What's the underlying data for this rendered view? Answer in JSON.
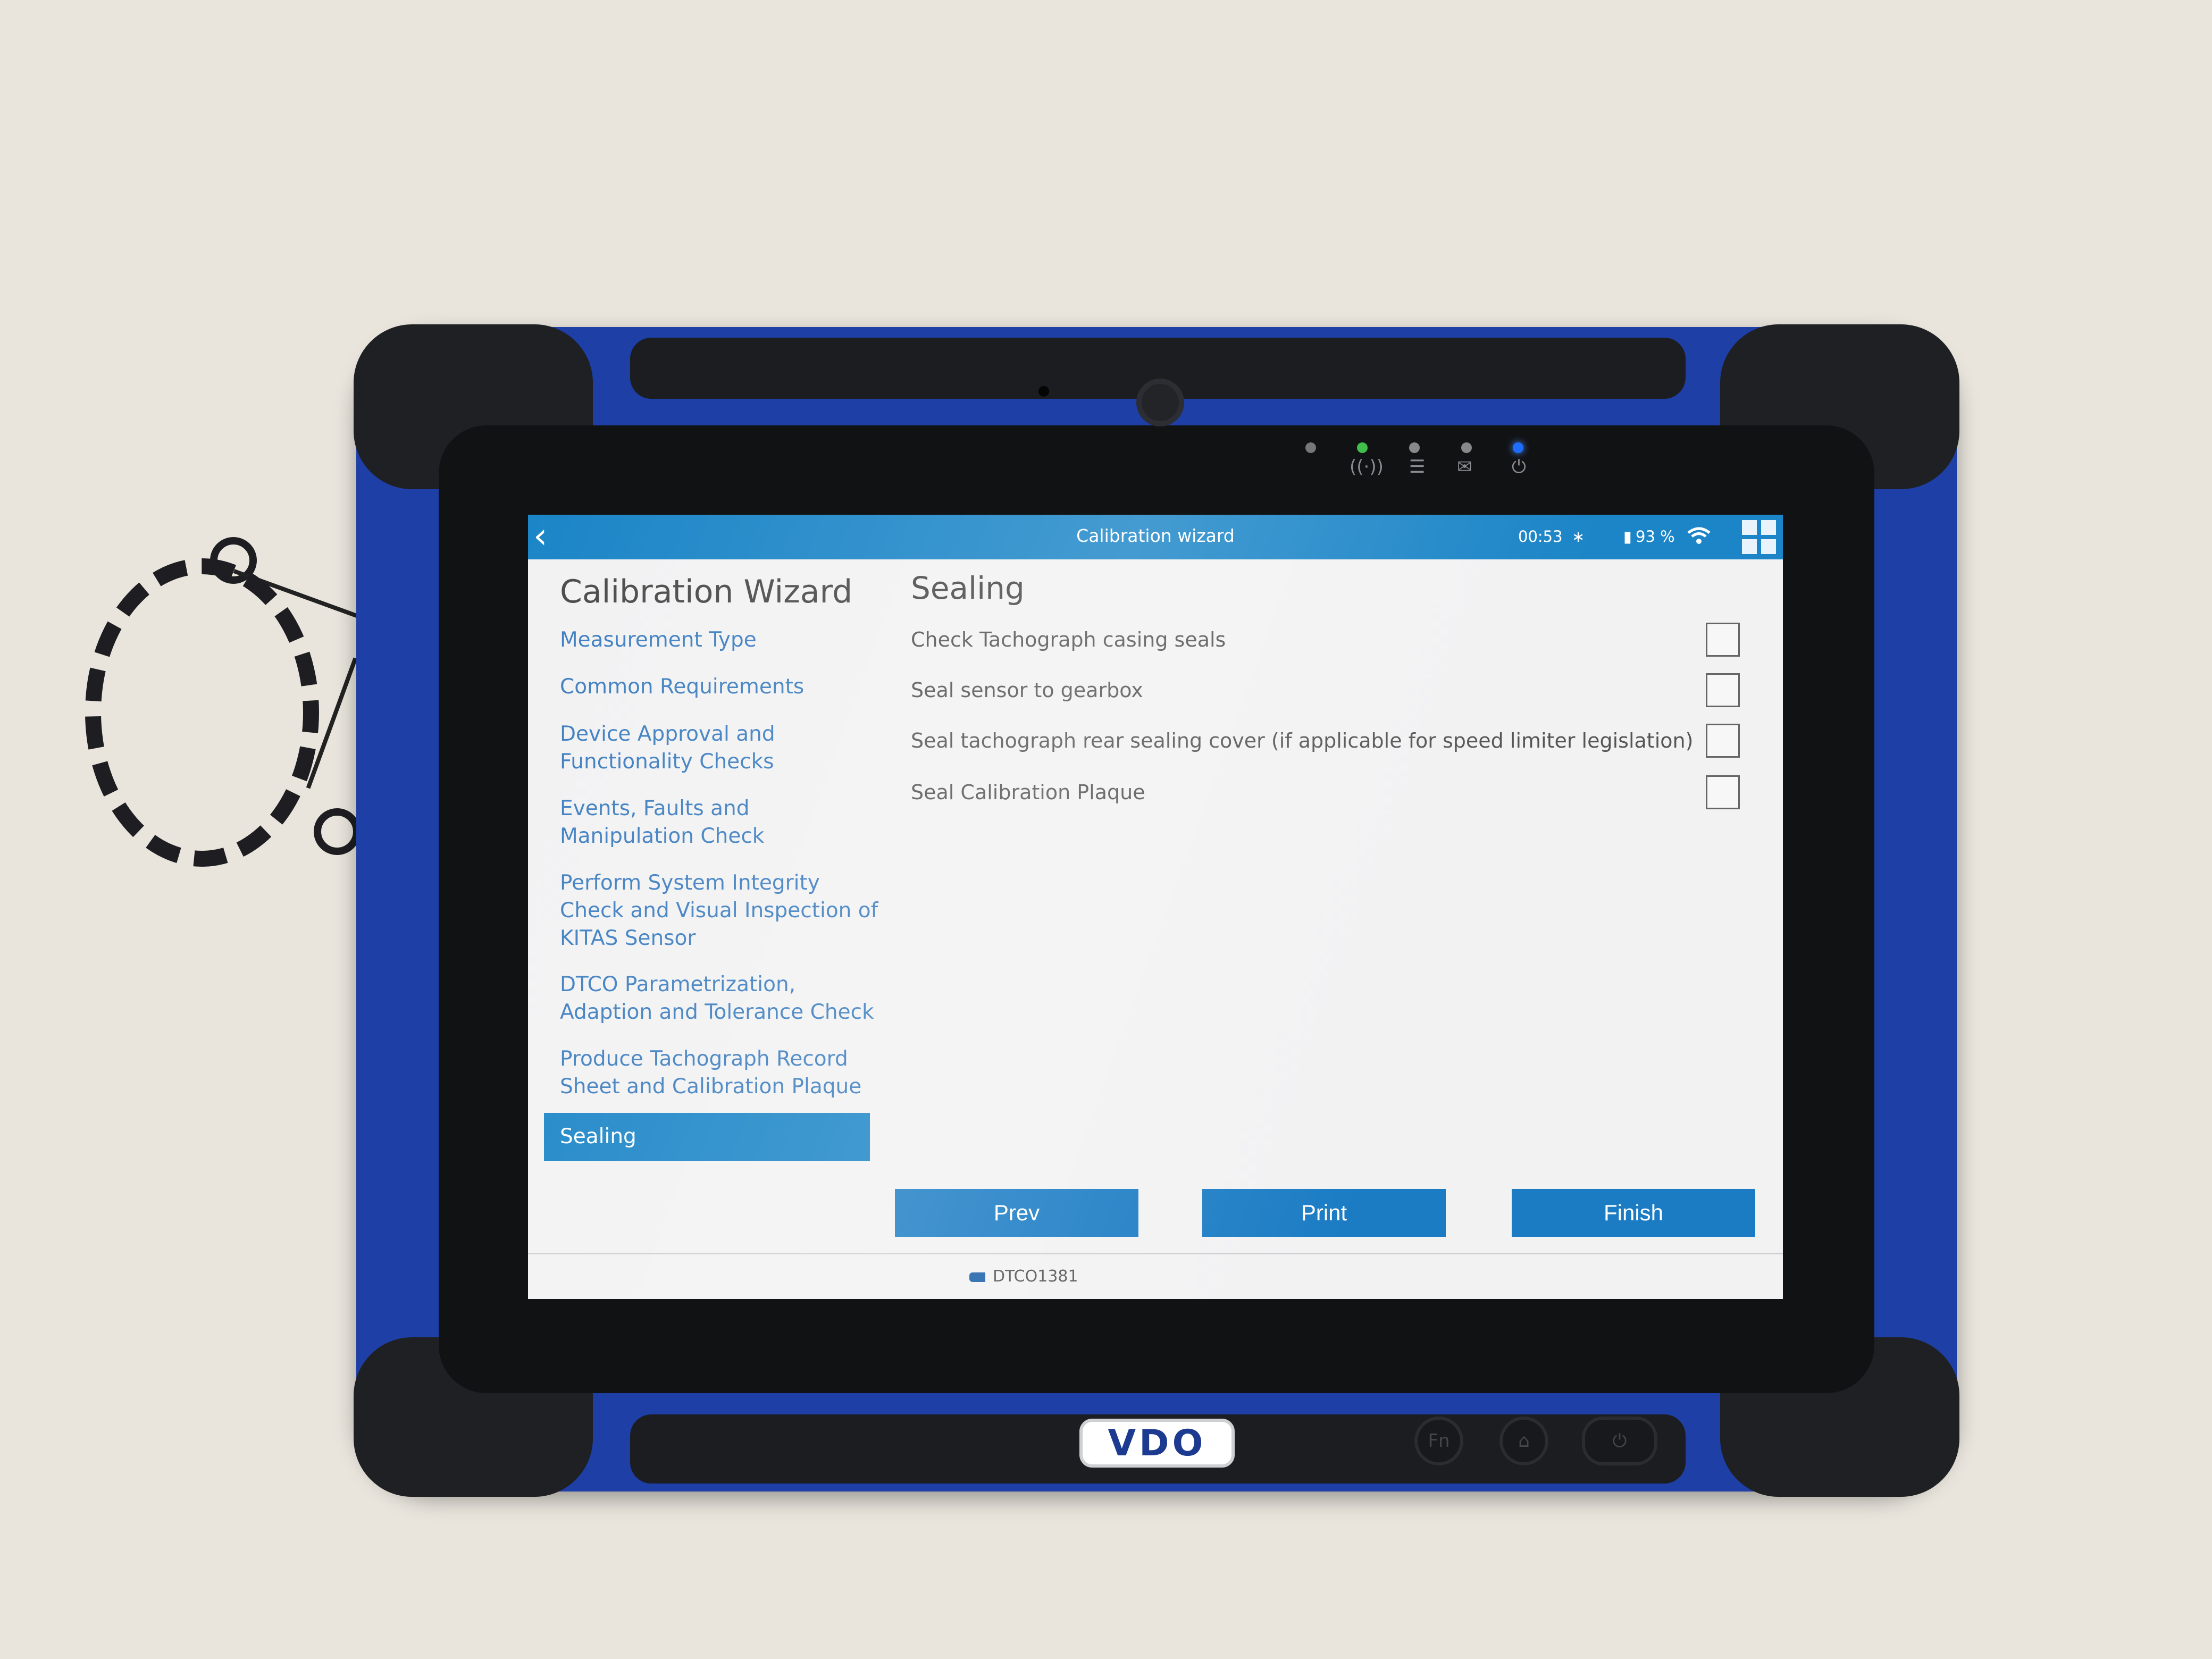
{
  "device": {
    "brand_logo": "VDO",
    "hardware_buttons": [
      "Fn",
      "home",
      "power"
    ],
    "indicator_leds": [
      {
        "icon": "wireless-icon",
        "color": "#3fbf4a"
      },
      {
        "icon": "list-icon",
        "color": "#888888"
      },
      {
        "icon": "mail-icon",
        "color": "#888888"
      },
      {
        "icon": "power-icon",
        "color": "#1f6dff"
      }
    ]
  },
  "appbar": {
    "title": "Calibration wizard",
    "time": "00:53",
    "battery": "93 %",
    "bluetooth_icon": "bluetooth-icon",
    "wifi_icon": "wifi-icon",
    "apps_icon": "grid-icon",
    "back_icon": "chevron-left-icon"
  },
  "sidebar": {
    "title": "Calibration Wizard",
    "items": [
      {
        "label_lines": [
          "Measurement Type"
        ]
      },
      {
        "label_lines": [
          "Common Requirements"
        ]
      },
      {
        "label_lines": [
          "Device Approval and",
          "Functionality Checks"
        ]
      },
      {
        "label_lines": [
          "Events, Faults and",
          "Manipulation Check"
        ]
      },
      {
        "label_lines": [
          "Perform System Integrity",
          "Check and Visual Inspection of",
          "KITAS Sensor"
        ]
      },
      {
        "label_lines": [
          "DTCO Parametrization,",
          "Adaption and Tolerance Check"
        ]
      },
      {
        "label_lines": [
          "Produce Tachograph Record",
          "Sheet and Calibration Plaque"
        ]
      }
    ],
    "selected": "Sealing"
  },
  "main": {
    "title": "Sealing",
    "checks": [
      {
        "label": "Check Tachograph casing seals",
        "checked": false
      },
      {
        "label": "Seal sensor to gearbox",
        "checked": false
      },
      {
        "label": "Seal tachograph rear sealing cover (if applicable for speed limiter legislation)",
        "checked": false
      },
      {
        "label": "Seal Calibration Plaque",
        "checked": false
      }
    ]
  },
  "buttons": {
    "prev": "Prev",
    "print": "Print",
    "finish": "Finish"
  },
  "footer": {
    "device_id": "DTCO1381"
  },
  "colors": {
    "accent": "#1b85c7",
    "button": "#1b7cc4",
    "nav_link": "#3d7ec0",
    "tablet_frame": "#1d3fa6"
  }
}
